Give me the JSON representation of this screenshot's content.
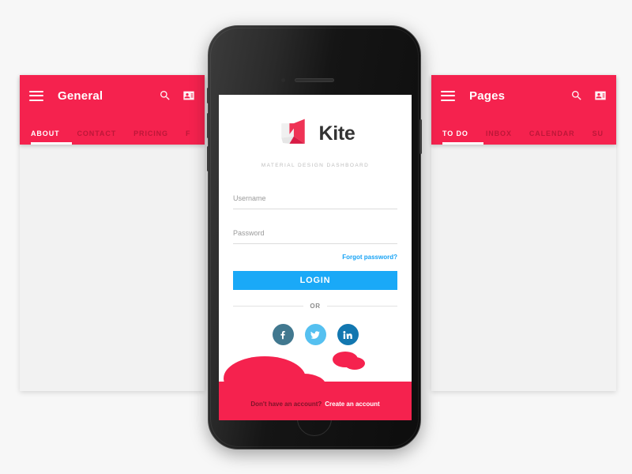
{
  "left_panel": {
    "title": "General",
    "menu_icon": "hamburger-icon",
    "search_icon": "search-icon",
    "contacts_icon": "contacts-icon",
    "tabs": [
      {
        "label": "ABOUT",
        "active": true
      },
      {
        "label": "CONTACT",
        "active": false
      },
      {
        "label": "PRICING",
        "active": false
      },
      {
        "label": "F",
        "active": false
      }
    ]
  },
  "right_panel": {
    "title": "Pages",
    "menu_icon": "hamburger-icon",
    "search_icon": "search-icon",
    "contacts_icon": "contacts-icon",
    "tabs": [
      {
        "label": "TO DO",
        "active": true
      },
      {
        "label": "INBOX",
        "active": false
      },
      {
        "label": "CALENDAR",
        "active": false
      },
      {
        "label": "SU",
        "active": false
      }
    ]
  },
  "phone": {
    "app": {
      "brand_name": "Kite",
      "brand_logo_icon": "kite-logo-icon",
      "tagline": "MATERIAL DESIGN DASHBOARD",
      "username": {
        "value": "",
        "placeholder": "Username"
      },
      "password": {
        "value": "",
        "placeholder": "Password"
      },
      "forgot_password": "Forgot password?",
      "login_button": "LOGIN",
      "divider_text": "OR",
      "socials": [
        {
          "name": "facebook",
          "icon": "facebook-icon",
          "color": "#41788f"
        },
        {
          "name": "twitter",
          "icon": "twitter-icon",
          "color": "#55c0f0"
        },
        {
          "name": "linkedin",
          "icon": "linkedin-icon",
          "color": "#1277b0"
        }
      ],
      "footer_prompt": "Don't have an account?",
      "footer_link": "Create an account"
    }
  },
  "colors": {
    "accent_red": "#f5224e",
    "accent_blue": "#1aa9f7",
    "link_blue": "#17a3f5",
    "panel_body": "#f2f2f2",
    "page_background": "#f7f7f7"
  }
}
